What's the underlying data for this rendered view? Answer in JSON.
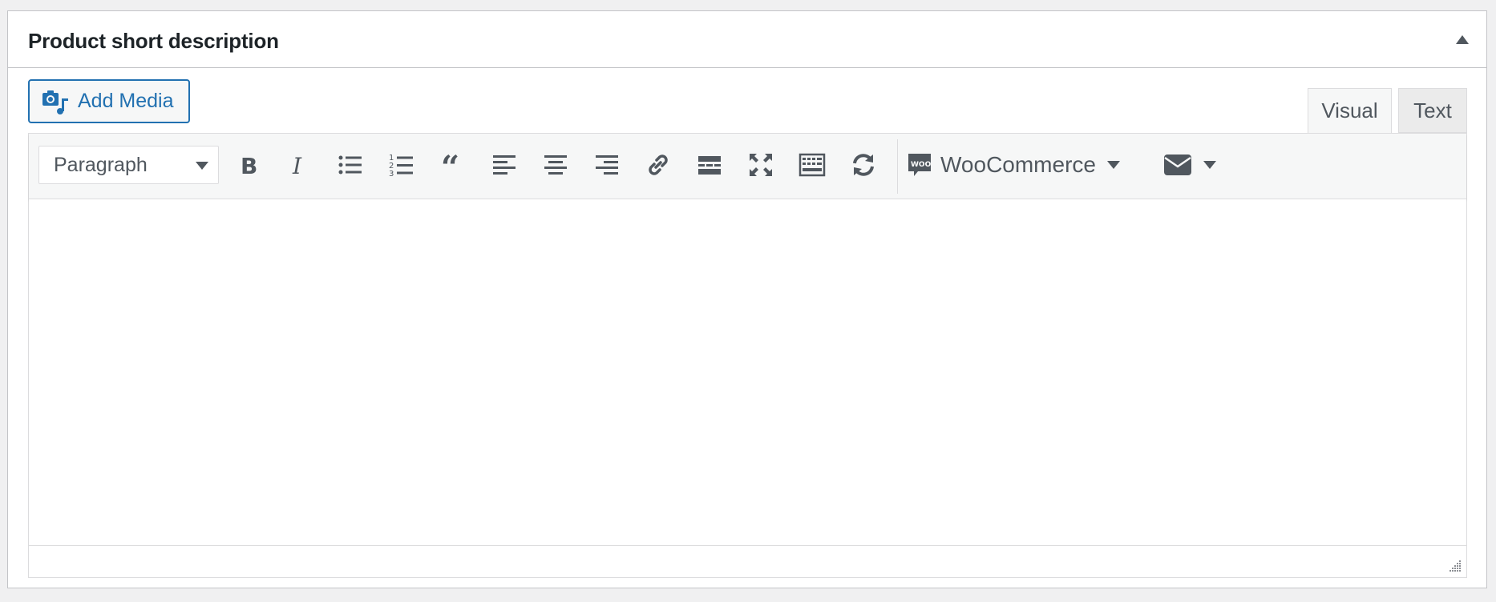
{
  "panel": {
    "title": "Product short description",
    "toggle_icon": "triangle-up-icon"
  },
  "add_media": {
    "label": "Add Media",
    "icon": "add-media-icon"
  },
  "tabs": [
    {
      "label": "Visual",
      "active": true
    },
    {
      "label": "Text",
      "active": false
    }
  ],
  "toolbar": {
    "format_value": "Paragraph",
    "buttons": [
      "bold-icon",
      "italic-icon",
      "bulleted-list-icon",
      "numbered-list-icon",
      "blockquote-icon",
      "align-left-icon",
      "align-center-icon",
      "align-right-icon",
      "link-icon",
      "read-more-icon",
      "fullscreen-icon",
      "toolbar-toggle-icon",
      "refresh-icon"
    ],
    "woocommerce_label": "WooCommerce",
    "mail_icon": "envelope-icon"
  },
  "colors": {
    "accent": "#2271b1",
    "icon": "#50575e",
    "border": "#dcdcde"
  }
}
